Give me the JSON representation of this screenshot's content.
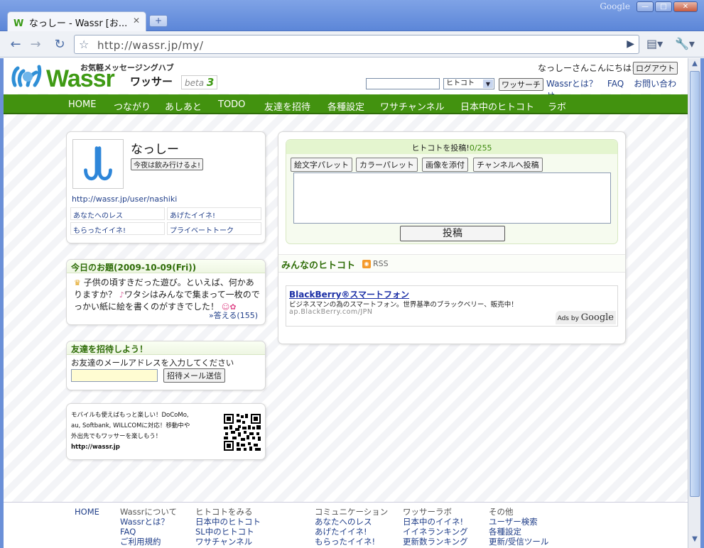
{
  "browser": {
    "brand": "Google",
    "tab_title": "なっしー - Wassr [お...",
    "url": "http://wassr.jp/my/",
    "window_buttons": {
      "minimize": "—",
      "maximize": "□",
      "close": "✕"
    }
  },
  "header": {
    "logo_text": "Wassr",
    "tagline": "お気軽メッセージングハブ",
    "logo_kana": "ワッサー",
    "beta_label": "beta",
    "beta_version": "3",
    "greeting": "なっしーさんこんにちは!",
    "logout_label": "ログアウト",
    "search_scope": "ヒトコト",
    "search_button": "ワッサーチ",
    "links": [
      "Wassrとは？",
      "FAQ",
      "お問い合わせ"
    ]
  },
  "nav": {
    "items": [
      "HOME",
      "つながり",
      "あしあと",
      "TODO",
      "友達を招待",
      "各種設定",
      "ワサチャンネル",
      "日本中のヒトコト",
      "ラボ"
    ]
  },
  "profile": {
    "name": "なっしー",
    "status": "今夜は飲み行けるよ!",
    "url": "http://wassr.jp/user/nashiki",
    "links": [
      "あなたへのレス",
      "あげたイイネ!",
      "もらったイイネ!",
      "プライベートトーク"
    ]
  },
  "topic": {
    "title": "今日のお題(2009-10-09(Fri))",
    "text_part1": "子供の頃すきだった遊び。といえば、何かありますか？",
    "text_part2": "ワタシはみんなで集まって一枚のでっかい紙に絵を書くのがすきでした！",
    "answer_link": "»答える(155)"
  },
  "invite": {
    "title": "友達を招待しよう！",
    "label": "お友達のメールアドレスを入力してください",
    "button": "招待メール送信"
  },
  "mobile": {
    "line1": "モバイルも使えばもっと楽しい！DoCoMo,",
    "line2": "au, Softbank, WILLCOMに対応！移動中や",
    "line3": "外出先でもワッサーを楽しもう！",
    "url": "http://wassr.jp"
  },
  "post": {
    "title": "ヒトコトを投稿!",
    "count": "0/255",
    "tools": [
      "絵文字パレット",
      "カラーパレット",
      "画像を添付",
      "チャンネルへ投稿"
    ],
    "submit": "投稿"
  },
  "stream": {
    "title": "みんなのヒトコト",
    "rss_label": "RSS"
  },
  "ad": {
    "title": "BlackBerry®スマートフォン",
    "description": "ビジネスマンの為のスマートフォン。世界基準のブラックベリー、販売中！",
    "url": "ap.BlackBerry.com/JPN",
    "ads_by": "Ads by",
    "ads_brand": "Google"
  },
  "footer": {
    "home": "HOME",
    "columns": [
      {
        "heading": "Wassrについて",
        "links": [
          "Wassrとは？",
          "FAQ",
          "ご利用規約"
        ]
      },
      {
        "heading": "ヒトコトをみる",
        "links": [
          "日本中のヒトコト",
          "SL中のヒトコト",
          "ワサチャンネル"
        ]
      },
      {
        "heading": "コミュニケーション",
        "links": [
          "あなたへのレス",
          "あげたイイネ!",
          "もらったイイネ!"
        ]
      },
      {
        "heading": "ワッサーラボ",
        "links": [
          "日本中のイイネ!",
          "イイネランキング",
          "更新数ランキング"
        ]
      },
      {
        "heading": "その他",
        "links": [
          "ユーザー検索",
          "各種設定",
          "更新/受信ツール"
        ]
      }
    ]
  }
}
